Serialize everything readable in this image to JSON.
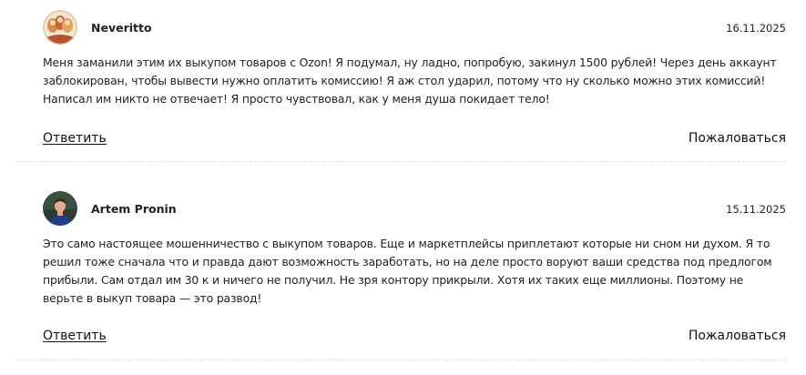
{
  "comments": [
    {
      "author": "Neveritto",
      "date": "16.11.2025",
      "text": "Меня заманили этим их выкупом товаров с Ozon! Я подумал, ну ладно, попробую, закинул 1500 рублей! Через день аккаунт заблокирован, чтобы вывести нужно оплатить комиссию! Я аж стол ударил, потому что ну сколько можно этих комиссий! Написал им никто не отвечает! Я просто чувствовал, как у меня душа покидает тело!",
      "reply_label": "Ответить",
      "report_label": "Пожаловаться"
    },
    {
      "author": "Artem Pronin",
      "date": "15.11.2025",
      "text": "Это само настоящее мошенничество с выкупом товаров. Еще и маркетплейсы приплетают которые ни сном ни духом. Я то решил тоже сначала что и правда дают возможность заработать, но на деле просто воруют ваши средства под предлогом прибыли. Сам отдал им 30 к и ничего не получил. Не зря контору прикрыли. Хотя их таких еще миллионы. Поэтому не верьте в выкуп товара — это развод!",
      "reply_label": "Ответить",
      "report_label": "Пожаловаться"
    }
  ]
}
